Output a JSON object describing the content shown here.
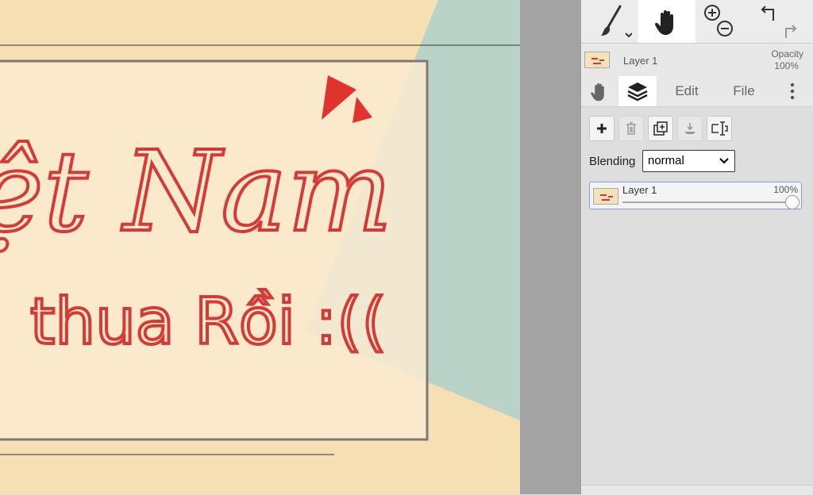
{
  "toolbar": {
    "brush_icon": "brush-icon",
    "hand_icon": "hand-icon",
    "zoom_in_icon": "zoom-in-icon",
    "zoom_out_icon": "zoom-out-icon",
    "undo_icon": "undo-icon",
    "redo_icon": "redo-icon"
  },
  "layer_header": {
    "name": "Layer 1",
    "opacity_label": "Opacity",
    "opacity_value": "100%"
  },
  "tabs": [
    {
      "icon": "hand-icon",
      "label": ""
    },
    {
      "icon": "layers-icon",
      "label": ""
    },
    {
      "label": "Edit"
    },
    {
      "label": "File"
    },
    {
      "icon": "more-vert-icon",
      "label": ""
    }
  ],
  "layer_actions": [
    {
      "name": "add-layer",
      "icon": "plus-icon",
      "enabled": true
    },
    {
      "name": "delete-layer",
      "icon": "trash-icon",
      "enabled": false
    },
    {
      "name": "duplicate-layer",
      "icon": "duplicate-icon",
      "enabled": true
    },
    {
      "name": "merge-down",
      "icon": "merge-down-icon",
      "enabled": false
    },
    {
      "name": "rename-layer",
      "icon": "rename-icon",
      "enabled": true
    }
  ],
  "blending": {
    "label": "Blending",
    "selected": "normal"
  },
  "layers": [
    {
      "name": "Layer 1",
      "opacity": "100%",
      "opacity_level": 1.0
    }
  ],
  "canvas": {
    "text_line1": "ệt Nam",
    "text_line2": "thua Rồi :(("
  },
  "colors": {
    "background_beige": "#f6dfb2",
    "teal_shape": "#b9d3c8",
    "card": "#fbead0",
    "ink_red": "#d53b36",
    "panel": "#dedede"
  }
}
